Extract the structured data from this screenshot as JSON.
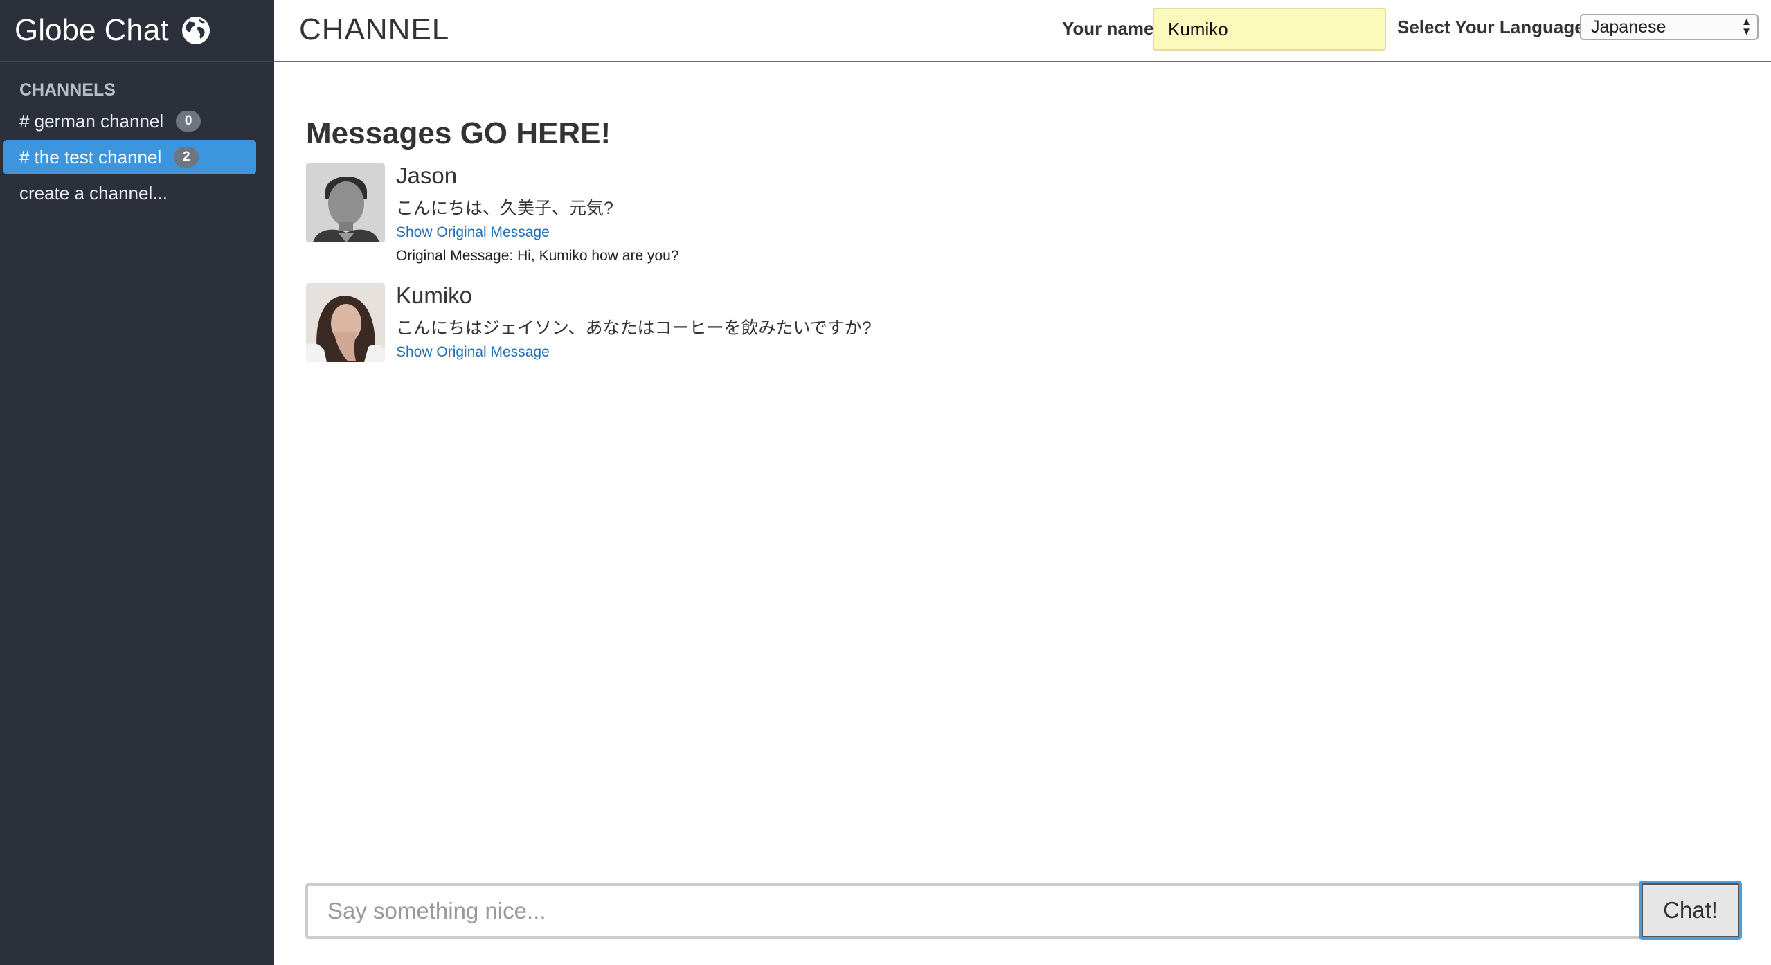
{
  "app": {
    "brand": "Globe Chat",
    "brand_icon": "globe-icon"
  },
  "sidebar": {
    "section_title": "CHANNELS",
    "channels": [
      {
        "label": "# german channel",
        "count": "0",
        "active": false
      },
      {
        "label": "# the test channel",
        "count": "2",
        "active": true
      }
    ],
    "create_label": "create a channel..."
  },
  "topbar": {
    "title": "CHANNEL",
    "name_label": "Your name",
    "name_value": "Kumiko",
    "language_label": "Select Your Language",
    "language_value": "Japanese"
  },
  "main": {
    "heading": "Messages GO HERE!",
    "messages": [
      {
        "author": "Jason",
        "text": "こんにちは、久美子、元気?",
        "show_original_label": "Show Original Message",
        "original": "Original Message: Hi, Kumiko how are you?"
      },
      {
        "author": "Kumiko",
        "text": "こんにちはジェイソン、あなたはコーヒーを飲みたいですか?",
        "show_original_label": "Show Original Message"
      }
    ]
  },
  "composer": {
    "placeholder": "Say something nice...",
    "button_label": "Chat!"
  },
  "colors": {
    "sidebar_bg": "#2b303b",
    "active_channel": "#3d95dd",
    "name_field_bg": "#fbf9bb",
    "link": "#2070b8"
  }
}
